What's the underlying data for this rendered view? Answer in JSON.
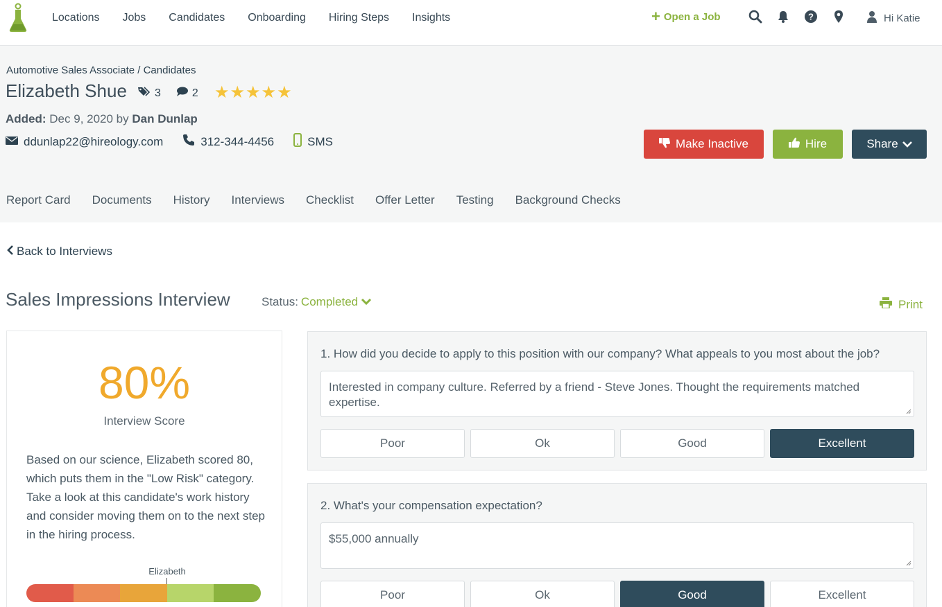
{
  "nav": {
    "links": [
      "Locations",
      "Jobs",
      "Candidates",
      "Onboarding",
      "Hiring Steps",
      "Insights"
    ],
    "open_job": "Open a Job",
    "user_greeting": "Hi Katie",
    "icons": [
      "search-icon",
      "bell-icon",
      "help-icon",
      "location-pin-icon",
      "user-icon"
    ]
  },
  "candidate": {
    "breadcrumb": "Automotive Sales Associate / Candidates",
    "name": "Elizabeth Shue",
    "tag_count": "3",
    "comment_count": "2",
    "rating": 5,
    "added_label": "Added:",
    "added_date": "Dec 9, 2020 by",
    "added_by": "Dan Dunlap",
    "email": "ddunlap22@hireology.com",
    "phone": "312-344-4456",
    "sms": "SMS"
  },
  "actions": {
    "make_inactive": "Make Inactive",
    "hire": "Hire",
    "share": "Share"
  },
  "tabs": [
    "Report Card",
    "Documents",
    "History",
    "Interviews",
    "Checklist",
    "Offer Letter",
    "Testing",
    "Background Checks"
  ],
  "interview": {
    "back": "Back to Interviews",
    "title": "Sales Impressions Interview",
    "status_label": "Status:",
    "status_value": "Completed",
    "print": "Print"
  },
  "score": {
    "value": "80%",
    "label": "Interview Score",
    "description": "Based on our science, Elizabeth scored 80, which puts them in the \"Low Risk\" category. Take a look at this candidate's work history and consider moving them on to the next step in the hiring process.",
    "marker_label": "Elizabeth",
    "marker_fraction": 0.6,
    "risk_colors": [
      "#e15b4a",
      "#ec8a55",
      "#e8a53a",
      "#b7d56a",
      "#8bb33f"
    ]
  },
  "questions": [
    {
      "text": "1.  How did you decide to apply to this position with our company? What appeals to you most about the job?",
      "answer": "Interested in company culture. Referred by a friend - Steve Jones. Thought the requirements matched expertise.",
      "options": [
        "Poor",
        "Ok",
        "Good",
        "Excellent"
      ],
      "selected": "Excellent"
    },
    {
      "text": "2.  What's your compensation expectation?",
      "answer": "$55,000 annually",
      "options": [
        "Poor",
        "Ok",
        "Good",
        "Excellent"
      ],
      "selected": "Good"
    }
  ],
  "colors": {
    "accent_green": "#8bb33f",
    "danger_red": "#d9463d",
    "navy": "#2f4c5c",
    "score_orange": "#f0a92c",
    "star_yellow": "#f5c339"
  }
}
